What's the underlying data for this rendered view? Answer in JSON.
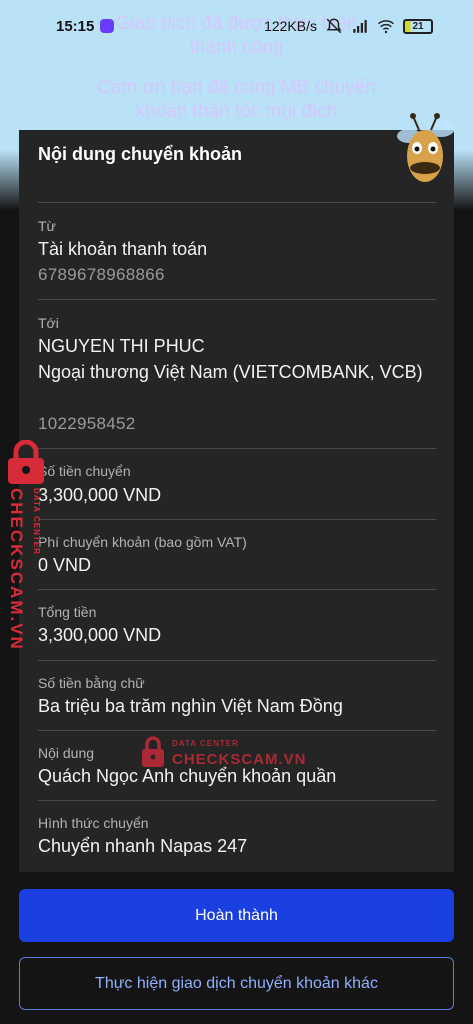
{
  "status_bar": {
    "time": "15:15",
    "net_speed": "122KB/s",
    "battery": "21"
  },
  "background": {
    "line1": "Giao dịch đã được thực hiện",
    "line2": "thành công",
    "line3": "Cảm ơn bạn đã cùng MB chuyển",
    "line4": "khoản thần tốc mọi đích"
  },
  "card": {
    "title": "Nội dung chuyển khoản",
    "from": {
      "label": "Từ",
      "name": "Tài khoản thanh toán",
      "account": "6789678968866"
    },
    "to": {
      "label": "Tới",
      "name": "NGUYEN THI PHUC",
      "bank": "Ngoại thương Việt Nam (VIETCOMBANK, VCB)",
      "account": "1022958452"
    },
    "amount": {
      "label": "Số tiền chuyển",
      "value": "3,300,000 VND"
    },
    "fee": {
      "label": "Phí chuyển khoản (bao gồm VAT)",
      "value": "0 VND"
    },
    "total": {
      "label": "Tổng tiền",
      "value": "3,300,000 VND"
    },
    "amount_words": {
      "label": "Số tiền bằng chữ",
      "value": "Ba triệu ba trăm nghìn Việt Nam Đồng"
    },
    "content": {
      "label": "Nội dung",
      "value": "Quách Ngọc Anh chuyển khoản quần"
    },
    "method": {
      "label": "Hình thức chuyển",
      "value": "Chuyển nhanh Napas 247"
    }
  },
  "watermark": {
    "side_text": "CHECKSCAM.VN",
    "side_sub": "DATA CENTER",
    "center_small": "DATA CENTER",
    "center_big": "CHECKSCAM.VN"
  },
  "buttons": {
    "done": "Hoàn thành",
    "another": "Thực hiện giao dịch chuyển khoản khác"
  },
  "colors": {
    "primary": "#1a3fe0",
    "card": "#252525",
    "watermark": "#d82b3a"
  }
}
